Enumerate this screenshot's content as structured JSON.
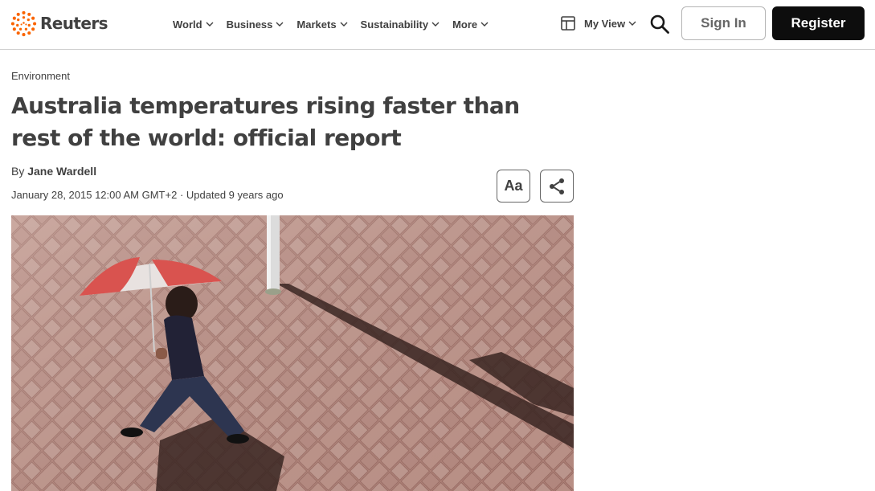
{
  "header": {
    "logo_text": "Reuters",
    "brand_color": "#fa6400",
    "nav": [
      {
        "label": "World"
      },
      {
        "label": "Business"
      },
      {
        "label": "Markets"
      },
      {
        "label": "Sustainability"
      },
      {
        "label": "More"
      }
    ],
    "myview_label": "My View",
    "signin_label": "Sign In",
    "register_label": "Register"
  },
  "article": {
    "category": "Environment",
    "headline": "Australia temperatures rising faster than rest of the world: official report",
    "by_prefix": "By",
    "author": "Jane Wardell",
    "date": "January 28, 2015 12:00 AM GMT+2",
    "updated": "· Updated 9 years ago",
    "font_button_label": "Aa"
  }
}
